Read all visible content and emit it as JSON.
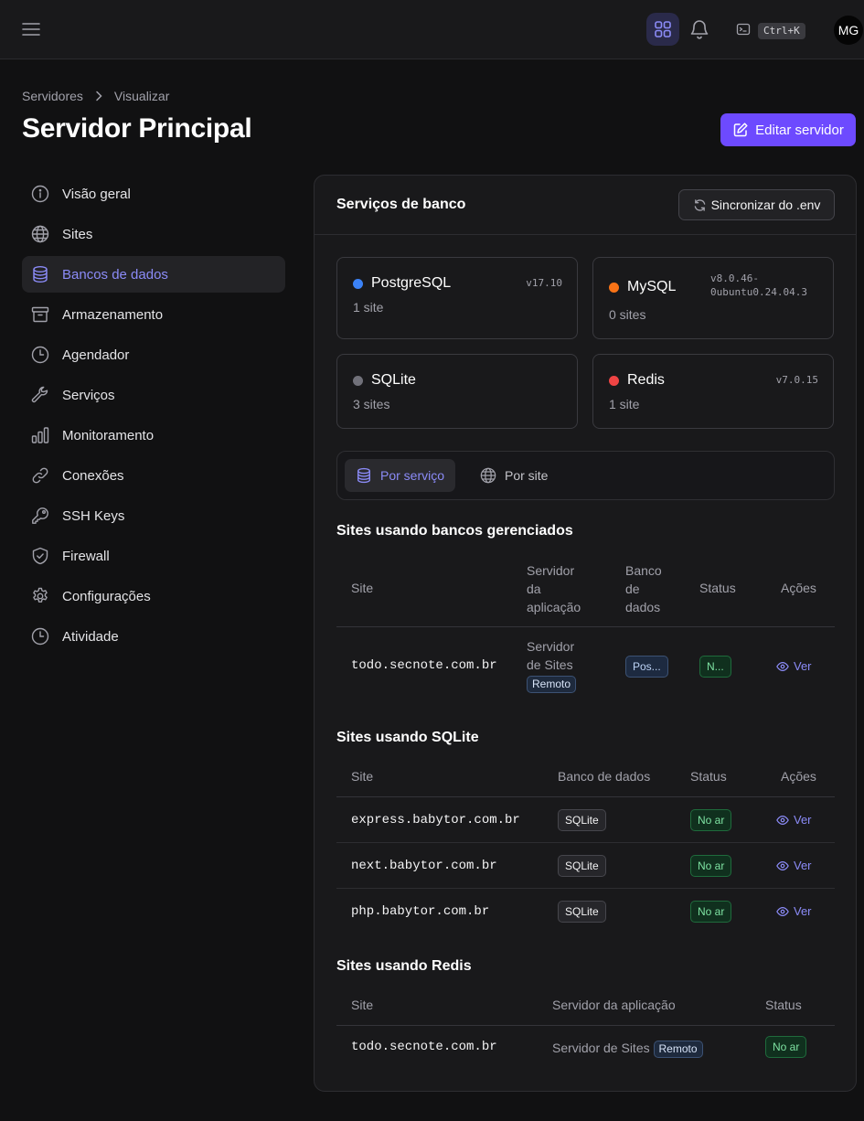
{
  "topbar": {
    "kbd": "Ctrl+K",
    "avatar": "MG"
  },
  "breadcrumb": {
    "root": "Servidores",
    "current": "Visualizar"
  },
  "page": {
    "title": "Servidor Principal",
    "edit_button": "Editar servidor"
  },
  "sidebar": {
    "items": [
      {
        "label": "Visão geral",
        "icon": "info-icon"
      },
      {
        "label": "Sites",
        "icon": "globe-icon"
      },
      {
        "label": "Bancos de dados",
        "icon": "database-icon",
        "active": true
      },
      {
        "label": "Armazenamento",
        "icon": "archive-icon"
      },
      {
        "label": "Agendador",
        "icon": "clock-icon"
      },
      {
        "label": "Serviços",
        "icon": "wrench-icon"
      },
      {
        "label": "Monitoramento",
        "icon": "bar-chart-icon"
      },
      {
        "label": "Conexões",
        "icon": "link-icon"
      },
      {
        "label": "SSH Keys",
        "icon": "key-icon"
      },
      {
        "label": "Firewall",
        "icon": "shield-check-icon"
      },
      {
        "label": "Configurações",
        "icon": "gear-icon"
      },
      {
        "label": "Atividade",
        "icon": "clock-icon"
      }
    ]
  },
  "panel": {
    "title": "Serviços de banco",
    "sync_button": "Sincronizar do .env"
  },
  "services": [
    {
      "name": "PostgreSQL",
      "count": "1 site",
      "version": "v17.10",
      "color": "#3b82f6"
    },
    {
      "name": "MySQL",
      "count": "0 sites",
      "version_line1": "v8.0.46-",
      "version_line2": "0ubuntu0.24.04.3",
      "color": "#f97316"
    },
    {
      "name": "SQLite",
      "count": "3 sites",
      "version": "",
      "color": "#71717a"
    },
    {
      "name": "Redis",
      "count": "1 site",
      "version": "v7.0.15",
      "color": "#ef4444"
    }
  ],
  "toggle": {
    "by_service": "Por serviço",
    "by_site": "Por site"
  },
  "managed": {
    "title": "Sites usando bancos gerenciados",
    "headers": {
      "site": "Site",
      "app_server_1": "Servidor",
      "app_server_2": "da",
      "app_server_3": "aplicação",
      "db_1": "Banco",
      "db_2": "de",
      "db_3": "dados",
      "status": "Status",
      "actions": "Ações"
    },
    "rows": [
      {
        "site": "todo.secnote.com.br",
        "server_1": "Servidor",
        "server_2": "de Sites",
        "server_badge": "Remoto",
        "db": "Pos...",
        "status": "N...",
        "action": "Ver"
      }
    ]
  },
  "sqlite": {
    "title": "Sites usando SQLite",
    "headers": {
      "site": "Site",
      "db": "Banco de dados",
      "status": "Status",
      "actions": "Ações"
    },
    "rows": [
      {
        "site": "express.babytor.com.br",
        "db": "SQLite",
        "status": "No ar",
        "action": "Ver"
      },
      {
        "site": "next.babytor.com.br",
        "db": "SQLite",
        "status": "No ar",
        "action": "Ver"
      },
      {
        "site": "php.babytor.com.br",
        "db": "SQLite",
        "status": "No ar",
        "action": "Ver"
      }
    ]
  },
  "redis": {
    "title": "Sites usando Redis",
    "headers": {
      "site": "Site",
      "app_server": "Servidor da aplicação",
      "status": "Status"
    },
    "rows": [
      {
        "site": "todo.secnote.com.br",
        "server": "Servidor de Sites",
        "server_badge": "Remoto",
        "status": "No ar"
      }
    ]
  }
}
